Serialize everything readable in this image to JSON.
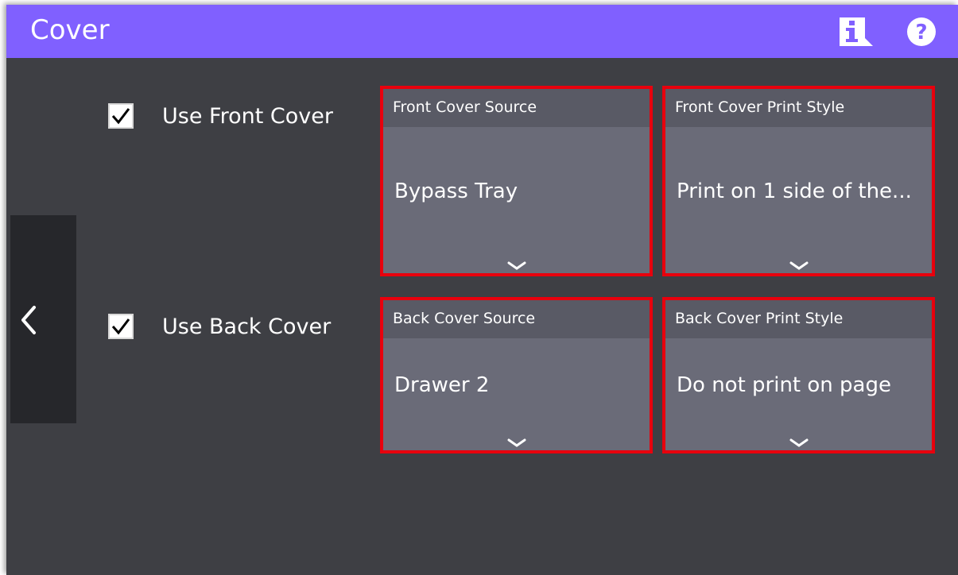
{
  "header": {
    "title": "Cover",
    "info_icon": "info-icon",
    "help_icon": "help-icon",
    "background_color": "#8060ff"
  },
  "nav": {
    "back_icon": "chevron-left-icon"
  },
  "front": {
    "checkbox_label": "Use Front Cover",
    "checked": true,
    "source": {
      "label": "Front Cover Source",
      "value": "Bypass Tray"
    },
    "print_style": {
      "label": "Front Cover Print Style",
      "value": "Print on 1 side of the..."
    }
  },
  "back": {
    "checkbox_label": "Use Back Cover",
    "checked": true,
    "source": {
      "label": "Back Cover Source",
      "value": "Drawer 2"
    },
    "print_style": {
      "label": "Back Cover Print Style",
      "value": "Do not print on page"
    }
  },
  "colors": {
    "highlight_border": "#e8000d",
    "panel_background": "#3e3f44",
    "card_background": "#6a6b78"
  }
}
